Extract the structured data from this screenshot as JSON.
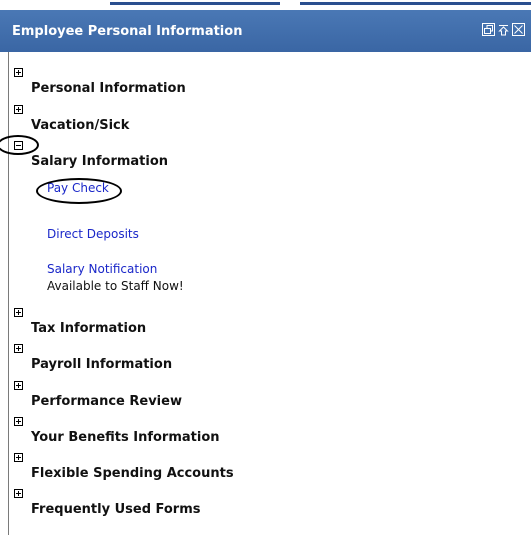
{
  "portlet": {
    "title": "Employee Personal Information",
    "controls": [
      {
        "icon": "restore-icon"
      },
      {
        "icon": "minimize-icon"
      },
      {
        "icon": "close-icon"
      }
    ]
  },
  "sections": [
    {
      "label": "Personal Information",
      "state": "collapsed"
    },
    {
      "label": "Vacation/Sick",
      "state": "collapsed"
    },
    {
      "label": "Salary Information",
      "state": "expanded",
      "links": [
        "Pay Check",
        "Direct Deposits",
        "Salary Notification"
      ],
      "note": "Available to Staff Now!"
    },
    {
      "label": "Tax Information",
      "state": "collapsed"
    },
    {
      "label": "Payroll Information",
      "state": "collapsed"
    },
    {
      "label": "Performance Review",
      "state": "collapsed"
    },
    {
      "label": "Your Benefits Information",
      "state": "collapsed"
    },
    {
      "label": "Flexible Spending Accounts",
      "state": "collapsed"
    },
    {
      "label": "Frequently Used Forms",
      "state": "collapsed"
    }
  ],
  "colors": {
    "titlebar": "#3f6eab",
    "link": "#1a27c9"
  }
}
